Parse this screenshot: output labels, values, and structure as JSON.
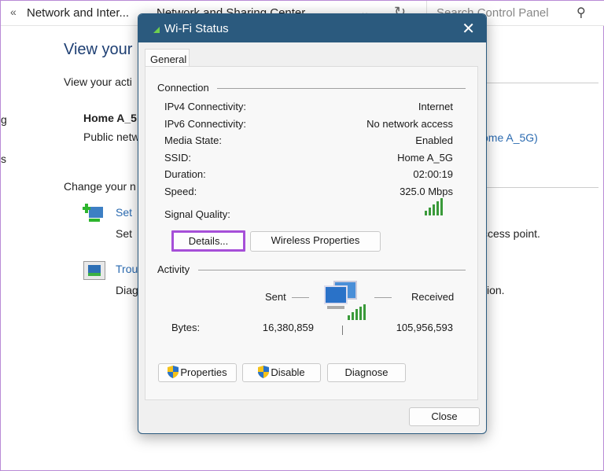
{
  "background": {
    "breadcrumb": [
      "Network and Inter...",
      "Network and Sharing Center"
    ],
    "search_placeholder": "Search Control Panel",
    "heading": "View your",
    "subheading": "View your acti",
    "network_name": "Home A_5",
    "network_type": "Public netw",
    "connection_link": "ome A_5G)",
    "change_heading": "Change your n",
    "setup_link": "Set",
    "setup_desc": "Set",
    "setup_desc_tail": "ccess point.",
    "trouble_link": "Trou",
    "trouble_desc": "Diag",
    "trouble_desc_tail": "ion.",
    "left_frag1": "g",
    "left_frag2": "s"
  },
  "dialog": {
    "title": "Wi-Fi Status",
    "tab": "General",
    "connection_label": "Connection",
    "rows": [
      {
        "label": "IPv4 Connectivity:",
        "value": "Internet"
      },
      {
        "label": "IPv6 Connectivity:",
        "value": "No network access"
      },
      {
        "label": "Media State:",
        "value": "Enabled"
      },
      {
        "label": "SSID:",
        "value": "Home A_5G"
      },
      {
        "label": "Duration:",
        "value": "02:00:19"
      },
      {
        "label": "Speed:",
        "value": "325.0 Mbps"
      }
    ],
    "signal_label": "Signal Quality:",
    "signal_bars": 5,
    "details_button": "Details...",
    "wireless_button": "Wireless Properties",
    "activity_label": "Activity",
    "sent_label": "Sent",
    "received_label": "Received",
    "bytes_label": "Bytes:",
    "bytes_sent": "16,380,859",
    "bytes_received": "105,956,593",
    "properties_button": "Properties",
    "disable_button": "Disable",
    "diagnose_button": "Diagnose",
    "close_button": "Close",
    "accent": "#2b5a7e",
    "focus_color": "#a64fd8"
  }
}
